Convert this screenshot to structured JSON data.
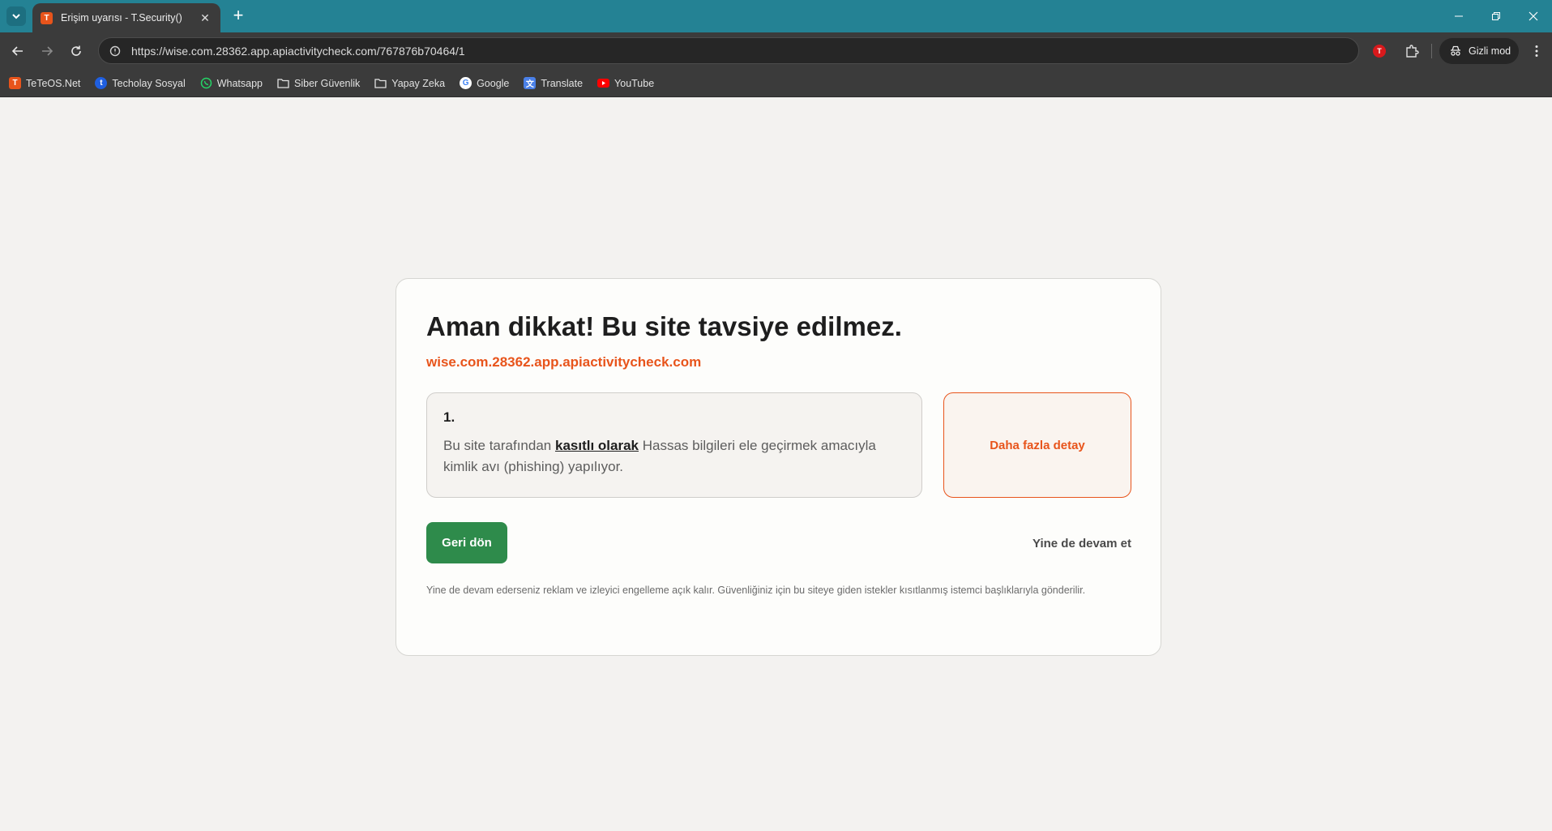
{
  "browser": {
    "tab": {
      "title": "Erişim uyarısı - T.Security()",
      "favicon": "T"
    },
    "address_bar": {
      "url": "https://wise.com.28362.app.apiactivitycheck.com/767876b70464/1"
    },
    "extension_badge": "T",
    "incognito_label": "Gizli mod",
    "bookmarks": [
      {
        "label": "TeTeOS.Net",
        "icon": "teteos-icon"
      },
      {
        "label": "Techolay Sosyal",
        "icon": "techolay-icon"
      },
      {
        "label": "Whatsapp",
        "icon": "whatsapp-icon"
      },
      {
        "label": "Siber Güvenlik",
        "icon": "folder-icon"
      },
      {
        "label": "Yapay Zeka",
        "icon": "folder-icon"
      },
      {
        "label": "Google",
        "icon": "google-icon"
      },
      {
        "label": "Translate",
        "icon": "translate-icon"
      },
      {
        "label": "YouTube",
        "icon": "youtube-icon"
      }
    ],
    "colors": {
      "tabstrip": "#248294",
      "toolbar": "#3b3b3b"
    }
  },
  "warning": {
    "title": "Aman dikkat! Bu site tavsiye edilmez.",
    "domain": "wise.com.28362.app.apiactivitycheck.com",
    "reason": {
      "number": "1.",
      "text_before": "Bu site tarafından ",
      "emphasis": "kasıtlı olarak",
      "text_after": " Hassas bilgileri ele geçirmek amacıyla kimlik avı (phishing) yapılıyor."
    },
    "details_button": "Daha fazla detay",
    "back_button": "Geri dön",
    "continue_link": "Yine de devam et",
    "footnote": "Yine de devam ederseniz reklam ve izleyici engelleme açık kalır. Güvenliğiniz için bu siteye giden istekler kısıtlanmış istemci başlıklarıyla gönderilir.",
    "colors": {
      "accent": "#e8541b",
      "back_button": "#2e8b4b",
      "page_bg": "#f3f2f0"
    }
  }
}
